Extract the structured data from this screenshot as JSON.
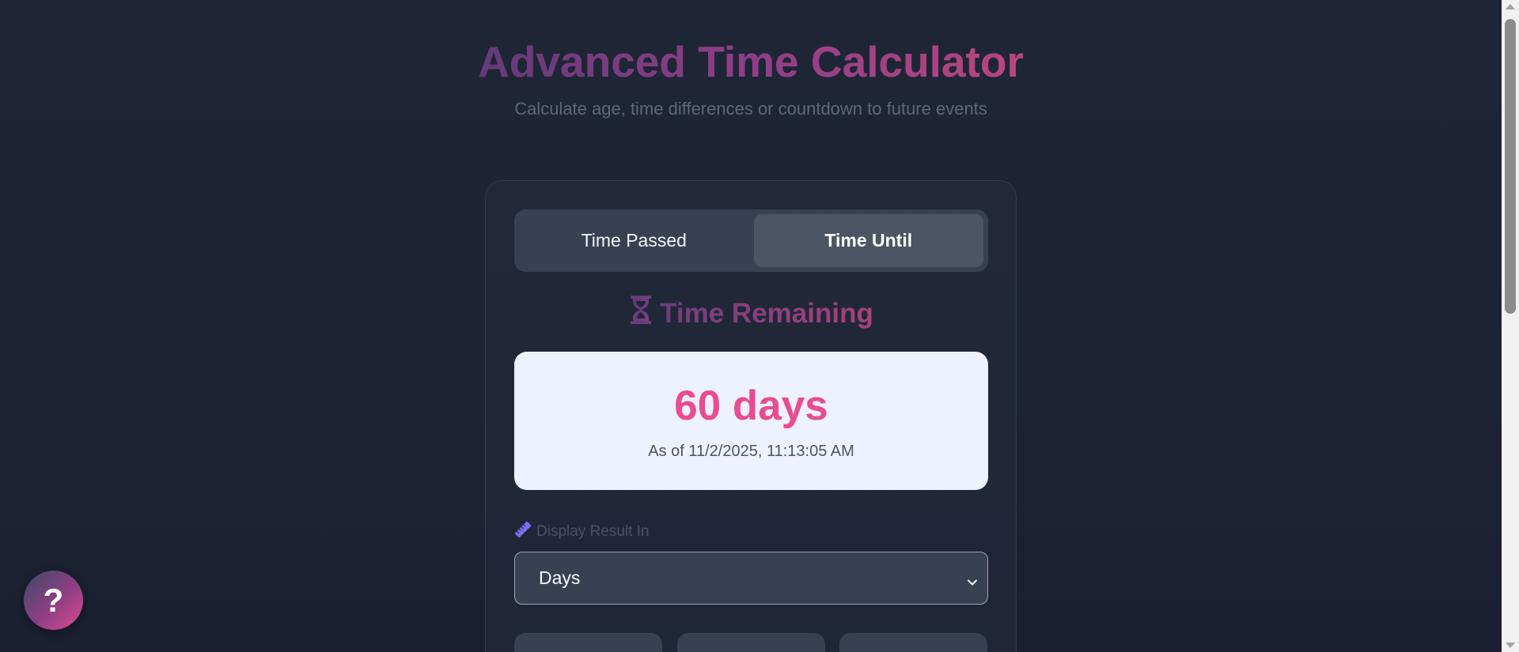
{
  "header": {
    "title": "Advanced Time Calculator",
    "subtitle": "Calculate age, time differences or countdown to future events"
  },
  "tabs": [
    {
      "label": "Time Passed",
      "active": false
    },
    {
      "label": "Time Until",
      "active": true
    }
  ],
  "result_section": {
    "icon": "hourglass-icon",
    "heading": "Time Remaining",
    "value": "60 days",
    "as_of": "As of 11/2/2025, 11:13:05 AM"
  },
  "display_unit": {
    "icon": "ruler-icon",
    "label": "Display Result In",
    "selected": "Days"
  },
  "help": {
    "icon": "question-mark-icon",
    "label": "?"
  },
  "colors": {
    "accent_pink": "#ea4b93",
    "accent_purple": "#6f3d7d",
    "ruler_icon": "#7b6ef0",
    "panel": "#374151",
    "result_bg": "#eef2fe"
  }
}
